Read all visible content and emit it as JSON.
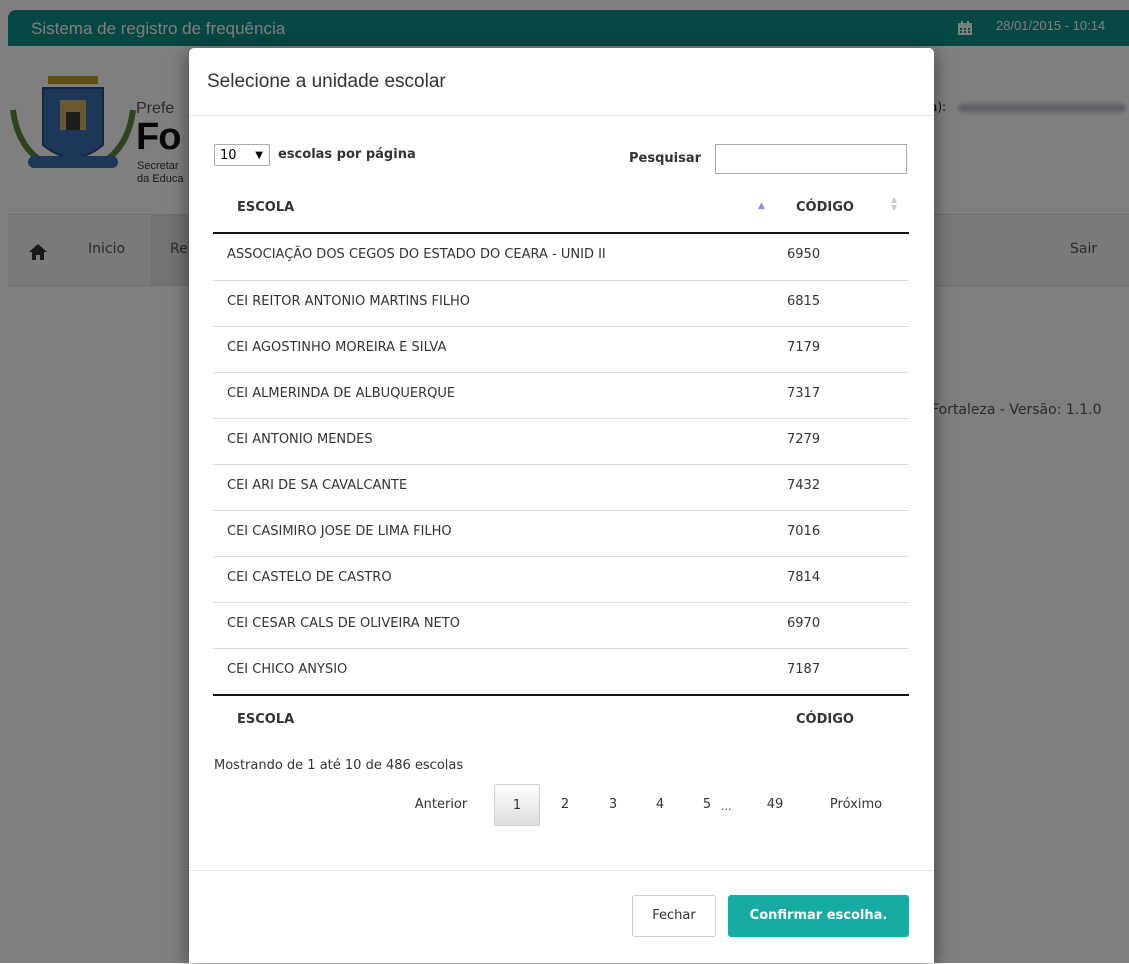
{
  "app": {
    "title": "Sistema de registro de frequência",
    "datetime": "28/01/2015 - 10:14",
    "logo_line1": "Prefe",
    "logo_line2": "Fo",
    "logo_line3a": "Secretar",
    "logo_line3b": "da Educa",
    "user_label": "a):",
    "nav": {
      "home": "Inicio",
      "partial": "Re",
      "logout": "Sair"
    },
    "footer": "e Fortaleza - Versão: 1.1.0"
  },
  "modal": {
    "title": "Selecione a unidade escolar",
    "length_value": "10",
    "length_label": "escolas por página",
    "search_label": "Pesquisar",
    "search_value": "",
    "columns": {
      "name": "ESCOLA",
      "code": "CÓDIGO"
    },
    "rows": [
      {
        "name": "ASSOCIAÇÃO DOS CEGOS DO ESTADO DO CEARA - UNID II",
        "code": "6950"
      },
      {
        "name": "CEI REITOR ANTONIO MARTINS FILHO",
        "code": "6815"
      },
      {
        "name": "CEI AGOSTINHO MOREIRA E SILVA",
        "code": "7179"
      },
      {
        "name": "CEI ALMERINDA DE ALBUQUERQUE",
        "code": "7317"
      },
      {
        "name": "CEI ANTONIO MENDES",
        "code": "7279"
      },
      {
        "name": "CEI ARI DE SA CAVALCANTE",
        "code": "7432"
      },
      {
        "name": "CEI CASIMIRO JOSE DE LIMA FILHO",
        "code": "7016"
      },
      {
        "name": "CEI CASTELO DE CASTRO",
        "code": "7814"
      },
      {
        "name": "CEI CESAR CALS DE OLIVEIRA NETO",
        "code": "6970"
      },
      {
        "name": "CEI CHICO ANYSIO",
        "code": "7187"
      }
    ],
    "info": "Mostrando de 1 até 10 de 486 escolas",
    "pagination": {
      "previous": "Anterior",
      "pages": [
        "1",
        "2",
        "3",
        "4",
        "5"
      ],
      "ellipsis": "...",
      "last": "49",
      "next": "Próximo",
      "current": "1"
    },
    "buttons": {
      "close": "Fechar",
      "confirm": "Confirmar escolha."
    }
  },
  "colors": {
    "brand": "#0a8f86",
    "confirm": "#16aca3",
    "sort_active": "#8a8af0"
  }
}
